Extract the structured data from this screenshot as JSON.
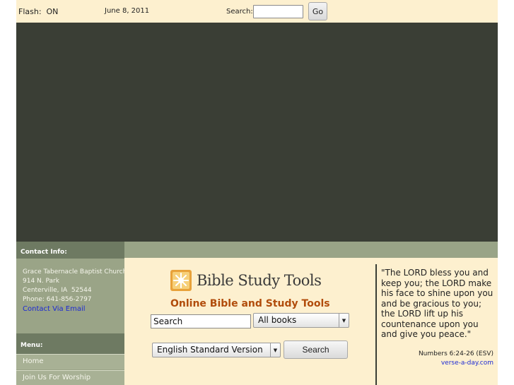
{
  "topbar": {
    "flash_text": "Flash:  ON",
    "date": "June 8, 2011",
    "search_label": "Search:",
    "search_value": "",
    "go_label": "Go"
  },
  "sidebar": {
    "contact_header": "Contact Info:",
    "contact_lines": [
      "Grace Tabernacle Baptist Church",
      "914 N. Park",
      "Centerville, IA  52544",
      "Phone: 641-856-2797"
    ],
    "contact_link": "Contact Via Email",
    "menu_header": "Menu:",
    "menu_items": [
      "Home",
      "Join Us For Worship"
    ]
  },
  "bible_tools": {
    "logo_text": "Bible Study Tools",
    "tagline": "Online Bible and Study Tools",
    "search_value": "Search",
    "books_selected": "All books",
    "version_selected": "English Standard Version",
    "search_button": "Search"
  },
  "verse": {
    "text": "\"The LORD bless you and keep you; the LORD make his face to shine upon you and be gracious to you; the LORD lift up his countenance upon you and give you peace.\"",
    "reference": "Numbers 6:24-26 (ESV)",
    "source_link": "verse-a-day.com"
  },
  "colors": {
    "topbar_bg": "#fdf0cf",
    "dark_bg": "#3a3e35",
    "sidebar_bg": "#9aa487",
    "header_bg": "#6e7a62",
    "link": "#1d2ad4",
    "tagline": "#b14c0b"
  },
  "icons": {
    "logo": "sun-star-icon",
    "dropdown": "triangle-down-icon"
  }
}
